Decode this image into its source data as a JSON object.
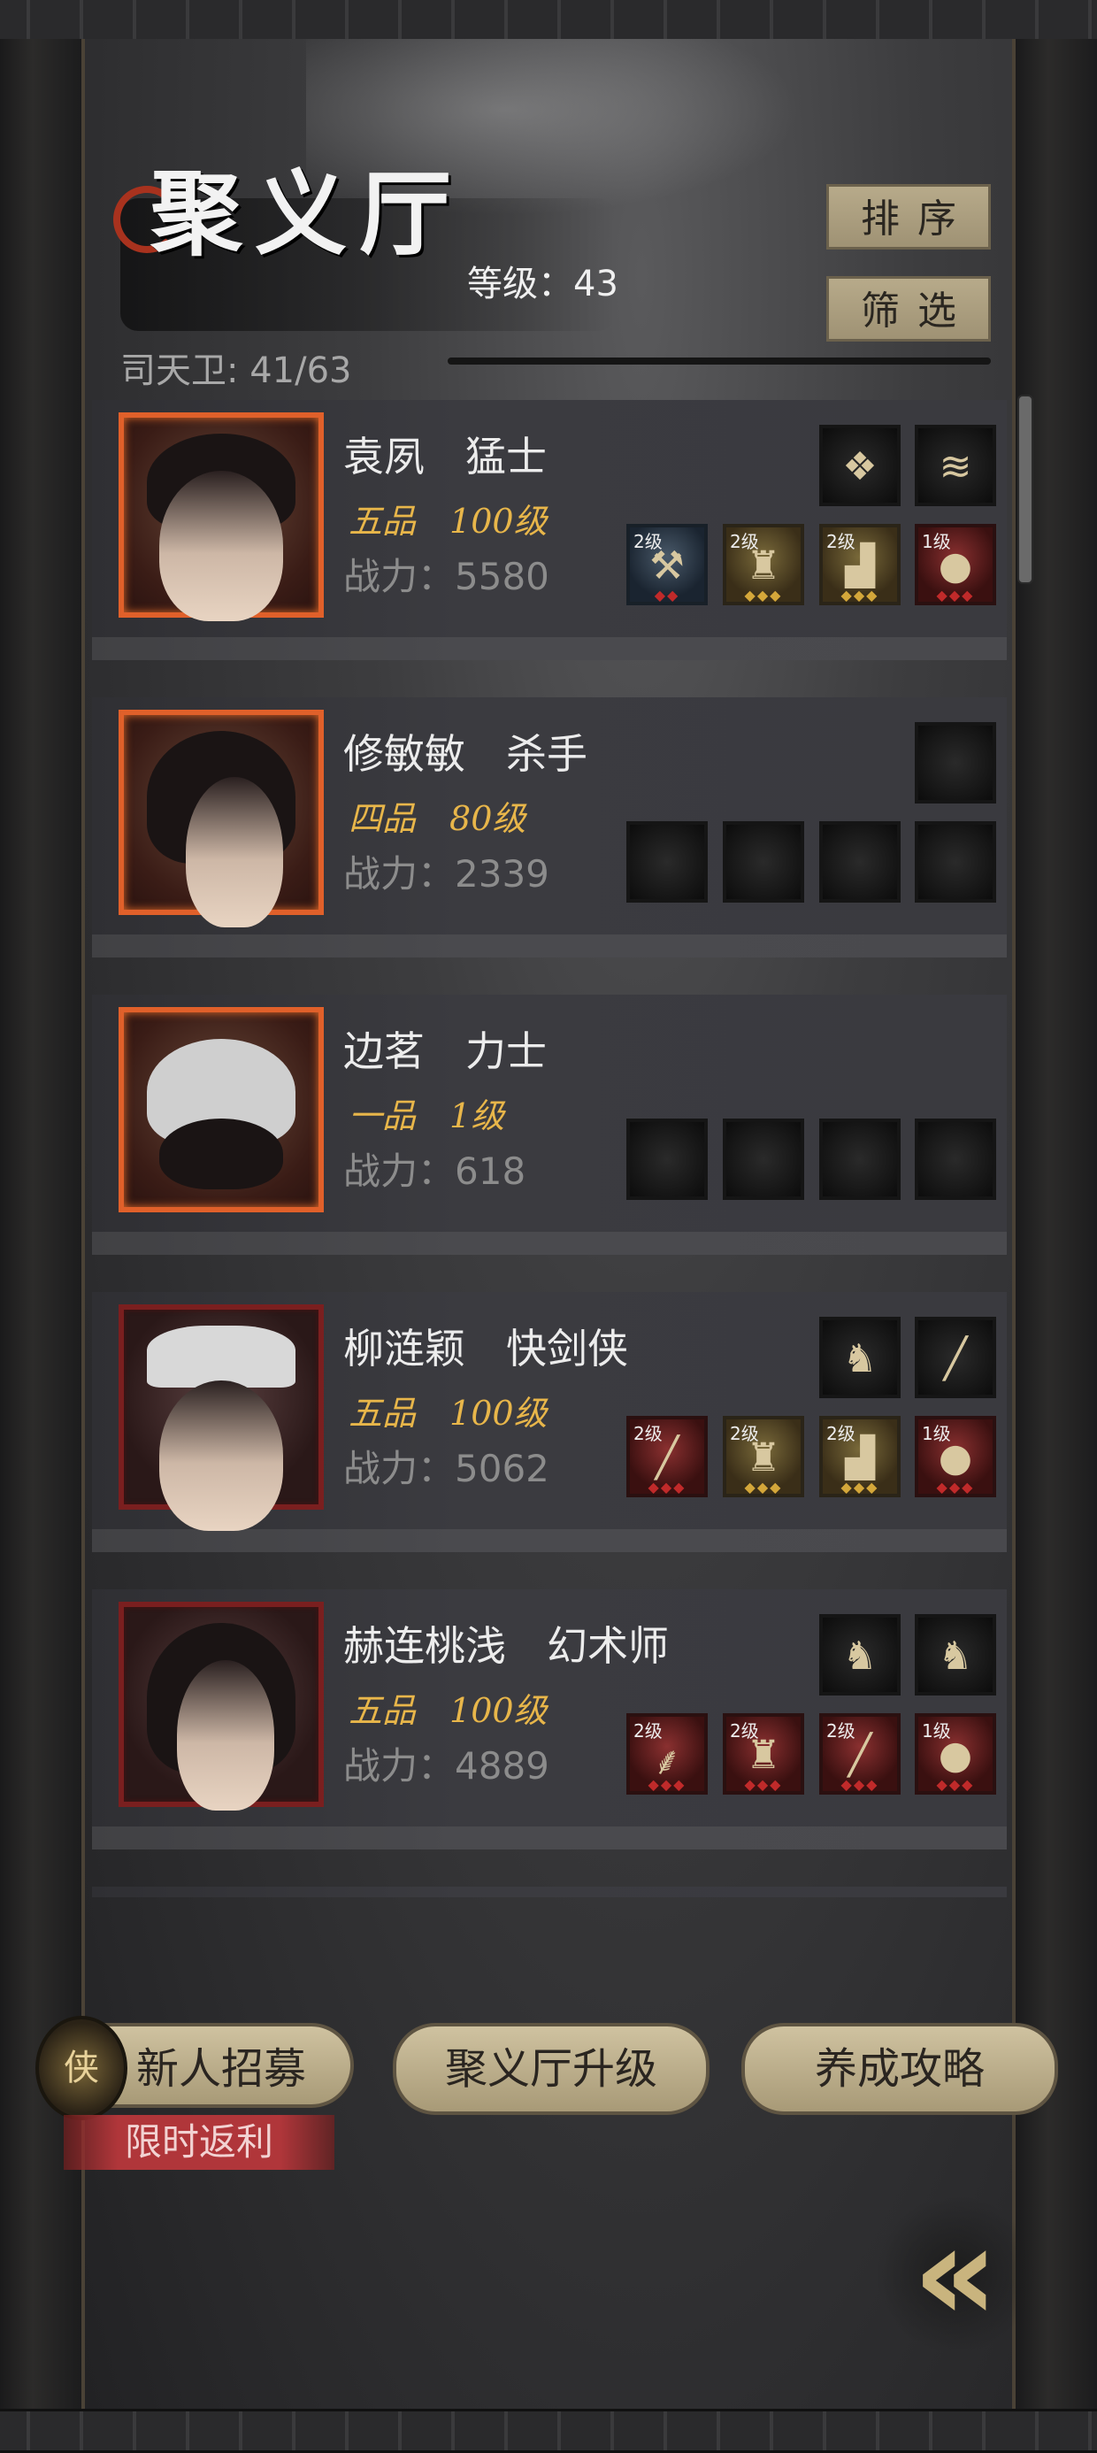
{
  "header": {
    "title": "聚义厅",
    "level_label": "等级：43",
    "roster_count": "司天卫: 41/63",
    "sort_label": "排序",
    "filter_label": "筛选"
  },
  "characters": [
    {
      "name": "袁夙",
      "class": "猛士",
      "rank": "五品",
      "level": "100级",
      "power": "战力：5580",
      "gear": [
        {
          "level": "2级",
          "icon": "hammer-icon",
          "tier": "blue"
        },
        {
          "level": "2级",
          "icon": "armor-icon",
          "tier": "gold"
        },
        {
          "level": "2级",
          "icon": "boots-icon",
          "tier": "gold"
        },
        {
          "level": "1级",
          "icon": "pouch-icon",
          "tier": "red"
        }
      ],
      "accessories": [
        "ornament-icon",
        "comb-icon"
      ]
    },
    {
      "name": "修敏敏",
      "class": "杀手",
      "rank": "四品",
      "level": "80级",
      "power": "战力：2339",
      "gear": [],
      "accessories": []
    },
    {
      "name": "边茗",
      "class": "力士",
      "rank": "一品",
      "level": "1级",
      "power": "战力：618",
      "gear": [],
      "accessories": []
    },
    {
      "name": "柳涟颖",
      "class": "快剑侠",
      "rank": "五品",
      "level": "100级",
      "power": "战力：5062",
      "gear": [
        {
          "level": "2级",
          "icon": "sword-icon",
          "tier": "red"
        },
        {
          "level": "2级",
          "icon": "armor-icon",
          "tier": "gold"
        },
        {
          "level": "2级",
          "icon": "boots-icon",
          "tier": "gold"
        },
        {
          "level": "1级",
          "icon": "pouch-icon",
          "tier": "red"
        }
      ],
      "accessories": [
        "rabbit-icon",
        "needle-icon"
      ]
    },
    {
      "name": "赫连桃浅",
      "class": "幻术师",
      "rank": "五品",
      "level": "100级",
      "power": "战力：4889",
      "gear": [
        {
          "level": "2级",
          "icon": "hook-icon",
          "tier": "red"
        },
        {
          "level": "2级",
          "icon": "robe-icon",
          "tier": "red"
        },
        {
          "level": "2级",
          "icon": "staff-icon",
          "tier": "red"
        },
        {
          "level": "1级",
          "icon": "pouch-icon",
          "tier": "red"
        }
      ],
      "accessories": [
        "rabbit-icon",
        "rabbit-icon"
      ]
    }
  ],
  "footer": {
    "recruit_label": "新人招募",
    "recruit_badge": "侠",
    "limited_label": "限时返利",
    "upgrade_label": "聚义厅升级",
    "guide_label": "养成攻略"
  }
}
